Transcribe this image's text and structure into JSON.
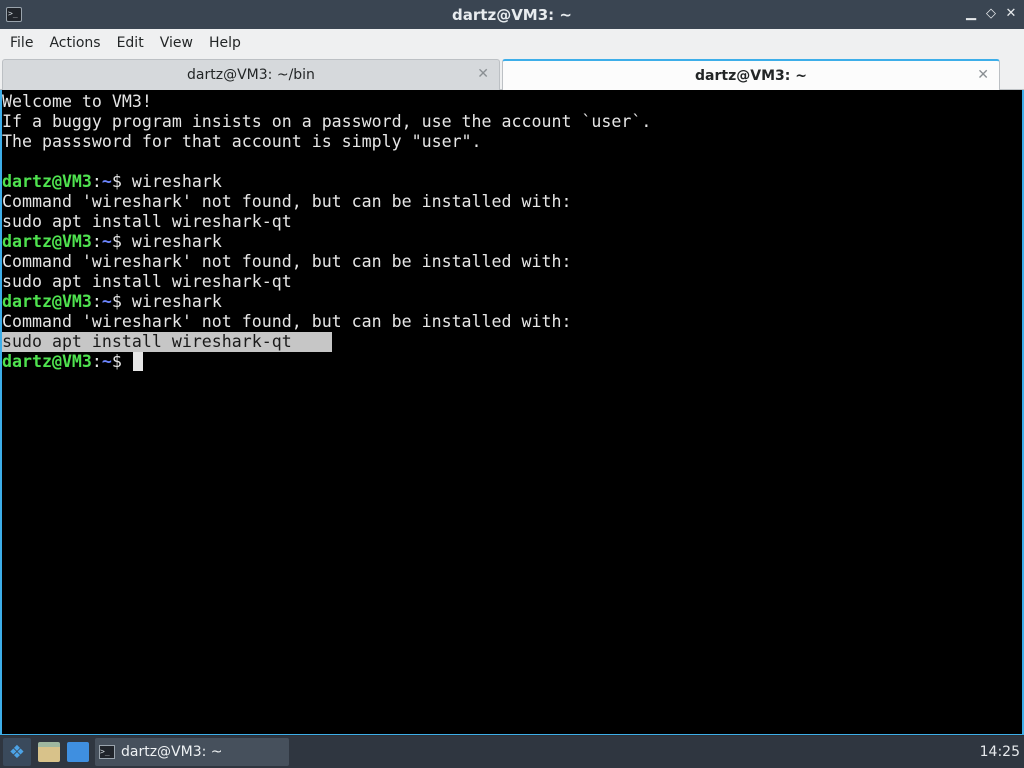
{
  "window": {
    "title": "dartz@VM3: ~",
    "app_icon": "terminal-icon",
    "buttons": [
      "minimize",
      "maximize",
      "close"
    ]
  },
  "menu": [
    "File",
    "Actions",
    "Edit",
    "View",
    "Help"
  ],
  "tabs": [
    {
      "label": "dartz@VM3: ~/bin",
      "active": false
    },
    {
      "label": "dartz@VM3: ~",
      "active": true
    }
  ],
  "terminal": {
    "motd": [
      "Welcome to VM3!",
      "If a buggy program insists on a password, use the account `user`.",
      "The passsword for that account is simply \"user\"."
    ],
    "prompt": {
      "user": "dartz@VM3",
      "colon": ":",
      "path": "~",
      "dollar": "$ "
    },
    "sessions": [
      {
        "command": "wireshark",
        "output": [
          "Command 'wireshark' not found, but can be installed with:",
          "sudo apt install wireshark-qt"
        ]
      },
      {
        "command": "wireshark",
        "output": [
          "Command 'wireshark' not found, but can be installed with:",
          "sudo apt install wireshark-qt"
        ]
      },
      {
        "command": "wireshark",
        "output": [
          "Command 'wireshark' not found, but can be installed with:",
          "sudo apt install wireshark-qt"
        ]
      }
    ],
    "selected_line": "sudo apt install wireshark-qt"
  },
  "taskbar": {
    "task_label": "dartz@VM3: ~",
    "clock": "14:25",
    "icons": [
      "app-launcher-icon",
      "file-manager-icon",
      "show-desktop-icon",
      "terminal-icon"
    ]
  },
  "colors": {
    "accent": "#3daee9",
    "prompt_user": "#4fe34f",
    "prompt_path": "#6d86ff"
  }
}
